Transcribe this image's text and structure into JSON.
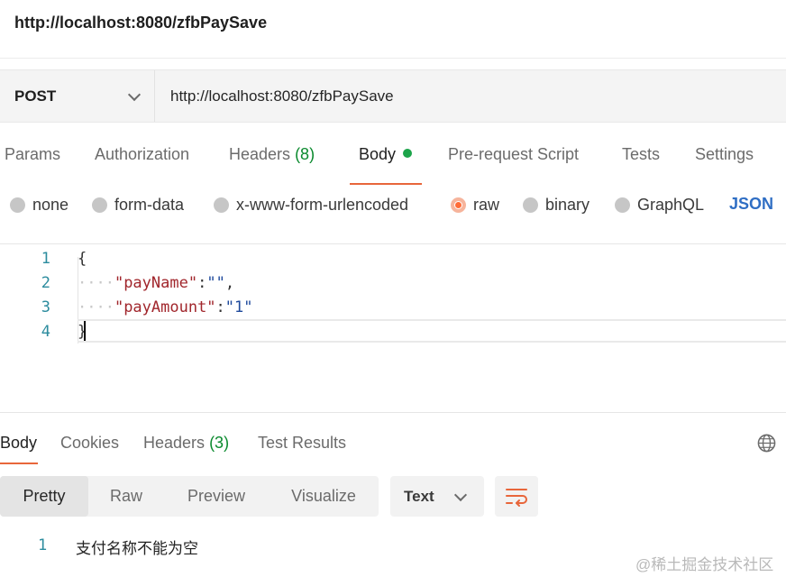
{
  "header": {
    "title": "http://localhost:8080/zfbPaySave"
  },
  "request": {
    "method": "POST",
    "url": "http://localhost:8080/zfbPaySave"
  },
  "request_tabs": {
    "params": "Params",
    "authorization": "Authorization",
    "headers": "Headers",
    "headers_count": "(8)",
    "body": "Body",
    "pre_request": "Pre-request Script",
    "tests": "Tests",
    "settings": "Settings"
  },
  "body_types": {
    "none": "none",
    "form_data": "form-data",
    "urlencoded": "x-www-form-urlencoded",
    "raw": "raw",
    "binary": "binary",
    "graphql": "GraphQL",
    "selected": "raw",
    "format": "JSON"
  },
  "editor": {
    "line_numbers": [
      "1",
      "2",
      "3",
      "4"
    ],
    "open_brace": "{",
    "indent": "····",
    "line2_key": "\"payName\"",
    "line2_colon": ":",
    "line2_value": "\"\"",
    "line2_comma": ",",
    "line3_key": "\"payAmount\"",
    "line3_colon": ":",
    "line3_value": "\"1\"",
    "close_brace": "}"
  },
  "response_tabs": {
    "body": "Body",
    "cookies": "Cookies",
    "headers": "Headers",
    "headers_count": "(3)",
    "test_results": "Test Results"
  },
  "view_modes": {
    "pretty": "Pretty",
    "raw": "Raw",
    "preview": "Preview",
    "visualize": "Visualize",
    "selected": "Pretty"
  },
  "response_format": "Text",
  "response_body": {
    "line_number": "1",
    "text": "支付名称不能为空"
  },
  "watermark": "@稀土掘金技术社区",
  "colors": {
    "accent": "#ff6c37",
    "success": "#1ca44a",
    "link": "#2f6ec4",
    "json_key": "#a1262c",
    "json_value": "#1f4a9c"
  }
}
